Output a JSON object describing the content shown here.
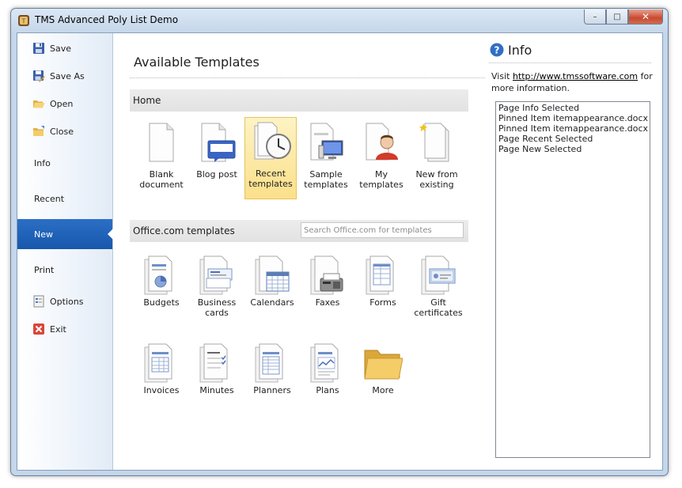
{
  "window": {
    "title": "TMS Advanced Poly List Demo",
    "close_glyph": "✕",
    "min_glyph": "–",
    "max_glyph": "□"
  },
  "sidebar": {
    "items": [
      {
        "label": "Save",
        "icon": "save-icon"
      },
      {
        "label": "Save As",
        "icon": "save-as-icon"
      },
      {
        "label": "Open",
        "icon": "open-folder-icon"
      },
      {
        "label": "Close",
        "icon": "close-folder-icon"
      },
      {
        "label": "Info"
      },
      {
        "label": "Recent"
      },
      {
        "label": "New",
        "active": true
      },
      {
        "label": "Print"
      },
      {
        "label": "Options",
        "icon": "options-icon"
      },
      {
        "label": "Exit",
        "icon": "exit-icon"
      }
    ],
    "accent_color": "#1d5fb5"
  },
  "main": {
    "title": "Available Templates",
    "home_section": {
      "label": "Home",
      "tiles": [
        {
          "label": "Blank document",
          "icon": "blank-document-icon"
        },
        {
          "label": "Blog post",
          "icon": "blog-post-icon"
        },
        {
          "label": "Recent templates",
          "icon": "recent-templates-icon",
          "selected": true
        },
        {
          "label": "Sample templates",
          "icon": "sample-templates-icon"
        },
        {
          "label": "My templates",
          "icon": "my-templates-icon"
        },
        {
          "label": "New from existing",
          "icon": "new-from-existing-icon"
        }
      ]
    },
    "office_section": {
      "label": "Office.com templates",
      "search_placeholder": "Search Office.com for templates",
      "tiles": [
        {
          "label": "Budgets",
          "icon": "budgets-icon"
        },
        {
          "label": "Business cards",
          "icon": "business-cards-icon"
        },
        {
          "label": "Calendars",
          "icon": "calendars-icon"
        },
        {
          "label": "Faxes",
          "icon": "faxes-icon"
        },
        {
          "label": "Forms",
          "icon": "forms-icon"
        },
        {
          "label": "Gift certificates",
          "icon": "gift-certificates-icon"
        },
        {
          "label": "Invoices",
          "icon": "invoices-icon"
        },
        {
          "label": "Minutes",
          "icon": "minutes-icon"
        },
        {
          "label": "Planners",
          "icon": "planners-icon"
        },
        {
          "label": "Plans",
          "icon": "plans-icon"
        },
        {
          "label": "More",
          "icon": "folder-icon"
        }
      ]
    }
  },
  "info": {
    "title": "Info",
    "visit_prefix": "Visit",
    "link_text": "http://www.tmssoftware.com",
    "visit_suffix": "for more information.",
    "log": [
      "Page Info Selected",
      "Pinned Item itemappearance.docx",
      "Pinned Item itemappearance.docx",
      "Page Recent Selected",
      "Page New Selected"
    ]
  }
}
